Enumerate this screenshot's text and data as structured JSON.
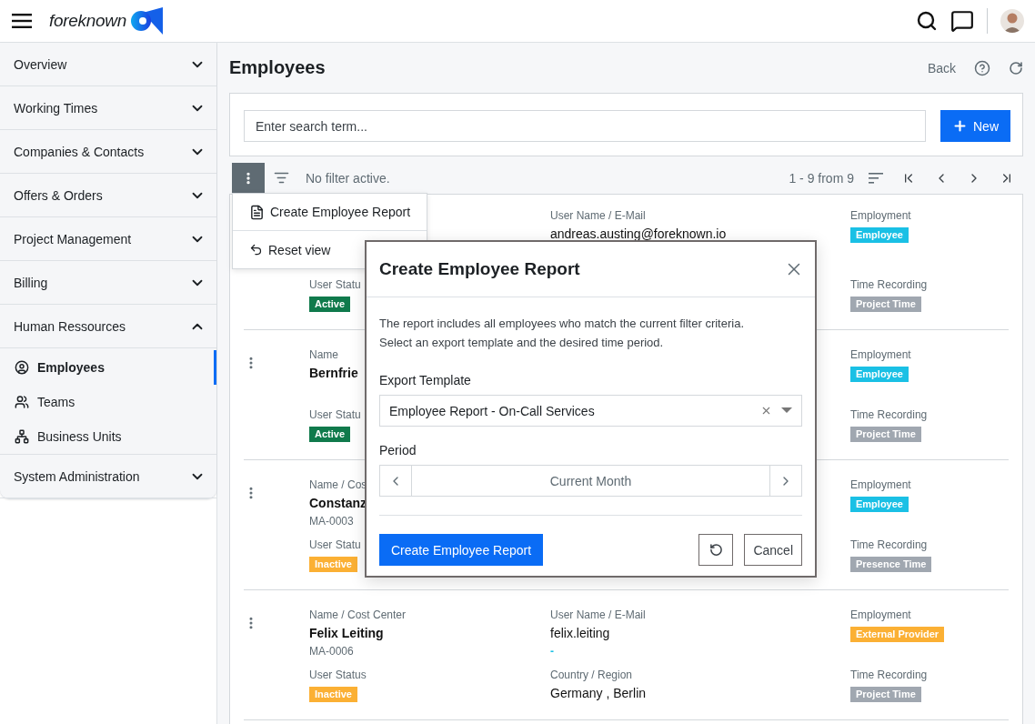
{
  "header": {
    "logo": "foreknown"
  },
  "sidebar": {
    "items": [
      {
        "label": "Overview",
        "expanded": false
      },
      {
        "label": "Working Times",
        "expanded": false
      },
      {
        "label": "Companies & Contacts",
        "expanded": false
      },
      {
        "label": "Offers & Orders",
        "expanded": false
      },
      {
        "label": "Project Management",
        "expanded": false
      },
      {
        "label": "Billing",
        "expanded": false
      },
      {
        "label": "Human Ressources",
        "expanded": true,
        "children": [
          {
            "label": "Employees",
            "selected": true
          },
          {
            "label": "Teams",
            "selected": false
          },
          {
            "label": "Business Units",
            "selected": false
          }
        ]
      },
      {
        "label": "System Administration",
        "expanded": false
      }
    ]
  },
  "page": {
    "title": "Employees",
    "back": "Back"
  },
  "search": {
    "placeholder": "Enter search term...",
    "new_button": "New"
  },
  "toolbar": {
    "filter_status": "No filter active.",
    "range": "1 - 9 from 9"
  },
  "actions_menu": {
    "items": [
      "Create Employee Report",
      "Reset view"
    ]
  },
  "rows": [
    {
      "has_menu": false,
      "columns": [
        {
          "bottom": {
            "label": "User Statu",
            "badge": {
              "text": "Active",
              "color": "#107a4c"
            }
          }
        },
        {
          "top": {
            "label": "User Name / E-Mail",
            "value": "andreas.austing@foreknown.io"
          }
        },
        {
          "top": {
            "label": "Employment",
            "badge": {
              "text": "Employee",
              "color": "#1ac0e5"
            }
          },
          "bottom": {
            "label": "Time Recording",
            "badge": {
              "text": "Project Time",
              "color": "#a0a7b0"
            }
          }
        }
      ]
    },
    {
      "has_menu": true,
      "columns": [
        {
          "top": {
            "label": "Name",
            "value": "Bernfrie"
          },
          "bottom": {
            "label": "User Statu",
            "badge": {
              "text": "Active",
              "color": "#107a4c"
            }
          }
        },
        {},
        {
          "top": {
            "label": "Employment",
            "badge": {
              "text": "Employee",
              "color": "#1ac0e5"
            }
          },
          "bottom": {
            "label": "Time Recording",
            "badge": {
              "text": "Project Time",
              "color": "#a0a7b0"
            }
          }
        }
      ]
    },
    {
      "has_menu": true,
      "columns": [
        {
          "top": {
            "label": "Name / Cos",
            "value": "Constanz",
            "sub": "MA-0003"
          },
          "bottom": {
            "label": "User Statu",
            "badge": {
              "text": "Inactive",
              "color": "#fbb034"
            }
          }
        },
        {},
        {
          "top": {
            "label": "Employment",
            "badge": {
              "text": "Employee",
              "color": "#1ac0e5"
            }
          },
          "bottom": {
            "label": "Time Recording",
            "badge": {
              "text": "Presence Time",
              "color": "#a0a7b0"
            }
          }
        }
      ]
    },
    {
      "has_menu": true,
      "columns": [
        {
          "top": {
            "label": "Name / Cost Center",
            "value": "Felix Leiting",
            "sub": "MA-0006"
          },
          "bottom": {
            "label": "User Status",
            "badge": {
              "text": "Inactive",
              "color": "#fbb034"
            }
          }
        },
        {
          "top": {
            "label": "User Name / E-Mail",
            "value": "felix.leiting",
            "sub": "-",
            "sub_link": true
          },
          "bottom": {
            "label": "Country / Region",
            "value": "Germany , Berlin"
          }
        },
        {
          "top": {
            "label": "Employment",
            "badge": {
              "text": "External Provider",
              "color": "#fbb034"
            }
          },
          "bottom": {
            "label": "Time Recording",
            "badge": {
              "text": "Project Time",
              "color": "#a0a7b0"
            }
          }
        }
      ]
    }
  ],
  "dialog": {
    "title": "Create Employee Report",
    "description": [
      "The report includes all employees who match the current filter criteria.",
      "Select an export template and the desired time period."
    ],
    "template": {
      "label": "Export Template",
      "value": "Employee Report - On-Call Services"
    },
    "period": {
      "label": "Period",
      "value": "Current Month"
    },
    "primary": "Create Employee Report",
    "cancel": "Cancel"
  }
}
